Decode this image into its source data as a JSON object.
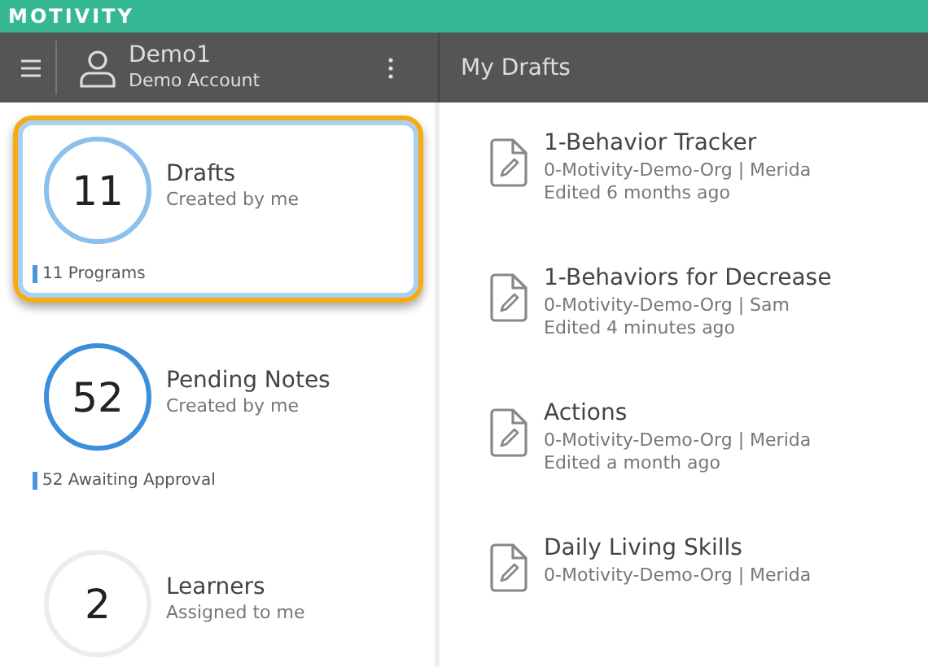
{
  "brand": {
    "logo": "MOTIVITY"
  },
  "account": {
    "name": "Demo1",
    "subtitle": "Demo Account"
  },
  "panel": {
    "title": "My Drafts"
  },
  "summary_cards": [
    {
      "count": "11",
      "title": "Drafts",
      "subtitle": "Created by me",
      "footer": "11 Programs",
      "color": "#8cbfeb",
      "selected": true
    },
    {
      "count": "52",
      "title": "Pending Notes",
      "subtitle": "Created by me",
      "footer": "52 Awaiting Approval",
      "color": "#3d8fdc",
      "selected": false
    },
    {
      "count": "2",
      "title": "Learners",
      "subtitle": "Assigned to me",
      "color": "#ececec",
      "selected": false
    }
  ],
  "drafts": [
    {
      "title": "1-Behavior Tracker",
      "meta": "0-Motivity-Demo-Org | Merida",
      "edited": "Edited 6 months ago"
    },
    {
      "title": "1-Behaviors for Decrease",
      "meta": "0-Motivity-Demo-Org | Sam",
      "edited": "Edited 4 minutes ago"
    },
    {
      "title": "Actions",
      "meta": "0-Motivity-Demo-Org | Merida",
      "edited": "Edited a month ago"
    },
    {
      "title": "Daily Living Skills",
      "meta": "0-Motivity-Demo-Org | Merida"
    }
  ]
}
